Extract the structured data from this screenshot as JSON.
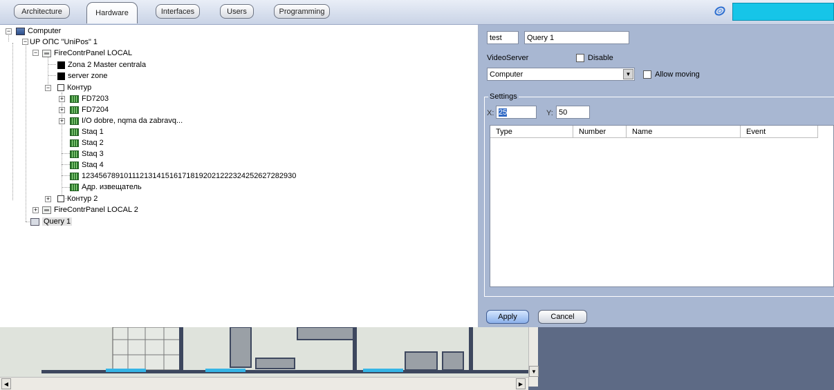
{
  "tabs": [
    "Architecture",
    "Hardware",
    "Interfaces",
    "Users",
    "Programming"
  ],
  "active_tab": "Hardware",
  "tree": {
    "computer": "Computer",
    "ops": "UP ОПС \"UniPos\" 1",
    "panel1": "FireContrPanel LOCAL",
    "zone1": "Zona 2 Master centrala",
    "zone2": "server zone",
    "kontur": "Контур",
    "fd1": "FD7203",
    "fd2": "FD7204",
    "io": "I/O dobre, nqma da zabravq...",
    "staq1": "Staq 1",
    "staq2": "Staq 2",
    "staq3": "Staq 3",
    "staq4": "Staq 4",
    "long": "123456789101112131415161718192021222324252627282930",
    "adr": "Адр. извещатель",
    "kontur2": "Контур 2",
    "panel2": "FireContrPanel LOCAL 2",
    "query": "Query 1"
  },
  "props": {
    "id_value": "test",
    "name_value": "Query 1",
    "videoserver_label": "VideoServer",
    "disable_label": "Disable",
    "combo_value": "Computer",
    "allow_moving_label": "Allow moving",
    "settings_label": "Settings",
    "x_label": "X:",
    "x_value": "25",
    "y_label": "Y:",
    "y_value": "50",
    "columns": [
      "Type",
      "Number",
      "Name",
      "Event"
    ],
    "apply_label": "Apply",
    "cancel_label": "Cancel"
  },
  "colors": {
    "accent_cyan": "#16c5e8",
    "panel_bg": "#a8b7d2",
    "map_bg": "#dfe3dc",
    "footer_dark": "#5d6a85"
  }
}
